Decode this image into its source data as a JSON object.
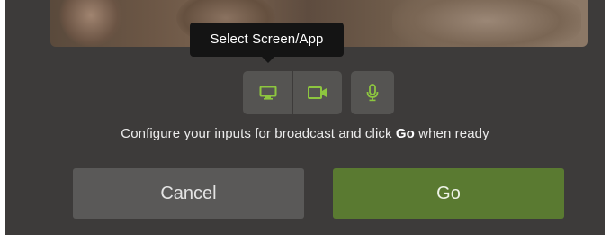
{
  "tooltip": {
    "text": "Select Screen/App"
  },
  "inputs": {
    "screen_icon": "monitor-icon",
    "camera_icon": "video-camera-icon",
    "mic_icon": "microphone-icon",
    "icon_color": "#8dc63f"
  },
  "instruction": {
    "prefix": "Configure your inputs for broadcast and click ",
    "bold": "Go",
    "suffix": " when ready"
  },
  "actions": {
    "cancel_label": "Cancel",
    "go_label": "Go",
    "go_color": "#5a7a31",
    "cancel_color": "#5a5958"
  }
}
